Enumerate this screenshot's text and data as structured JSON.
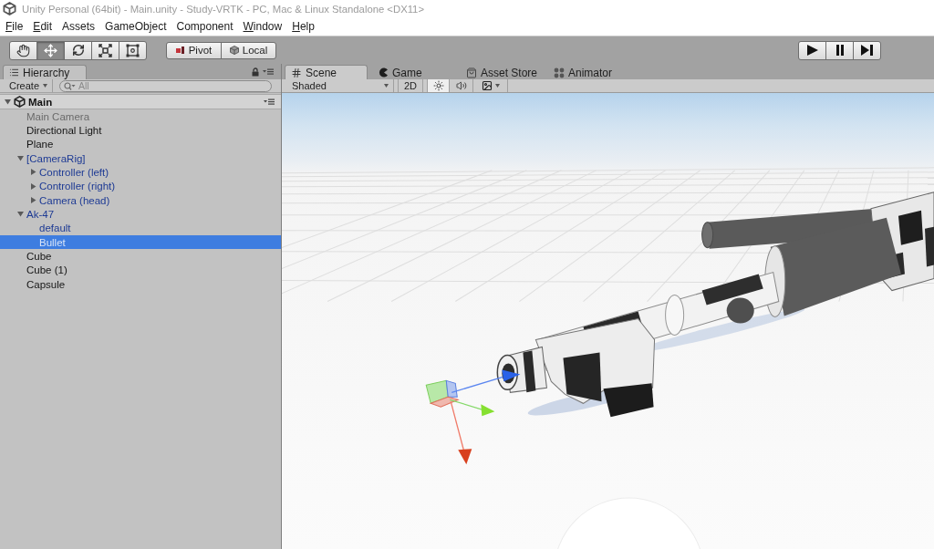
{
  "window": {
    "title": "Unity Personal (64bit) - Main.unity - Study-VRTK - PC, Mac & Linux Standalone <DX11>"
  },
  "menu_bar": [
    {
      "label": "File",
      "mnemonic": true
    },
    {
      "label": "Edit",
      "mnemonic": true
    },
    {
      "label": "Assets",
      "mnemonic": false
    },
    {
      "label": "GameObject",
      "mnemonic": false
    },
    {
      "label": "Component",
      "mnemonic": false
    },
    {
      "label": "Window",
      "mnemonic": true
    },
    {
      "label": "Help",
      "mnemonic": true
    }
  ],
  "toolbar": {
    "tools": [
      {
        "kind": "hand",
        "selected": false
      },
      {
        "kind": "move",
        "selected": true
      },
      {
        "kind": "rotate",
        "selected": false
      },
      {
        "kind": "scale",
        "selected": false
      },
      {
        "kind": "rect",
        "selected": false
      }
    ],
    "handle_buttons": [
      {
        "kind": "pivot",
        "label": "Pivot"
      },
      {
        "kind": "local",
        "label": "Local"
      }
    ],
    "play_controls": [
      {
        "kind": "play"
      },
      {
        "kind": "pause"
      },
      {
        "kind": "step"
      }
    ]
  },
  "hierarchy": {
    "tab": "Hierarchy",
    "create_button": "Create",
    "search": {
      "placeholder": "All"
    },
    "scene": {
      "name": "Main",
      "expanded": true,
      "children": [
        {
          "name": "Main Camera",
          "prefab": false,
          "active": false,
          "selected": false
        },
        {
          "name": "Directional Light",
          "prefab": false,
          "active": true,
          "selected": false
        },
        {
          "name": "Plane",
          "prefab": false,
          "active": true,
          "selected": false
        },
        {
          "name": "[CameraRig]",
          "expanded": true,
          "prefab": true,
          "active": true,
          "selected": false,
          "children": [
            {
              "name": "Controller (left)",
              "expanded": false,
              "prefab": true,
              "active": true,
              "selected": false
            },
            {
              "name": "Controller (right)",
              "expanded": false,
              "prefab": true,
              "active": true,
              "selected": false
            },
            {
              "name": "Camera (head)",
              "expanded": false,
              "prefab": true,
              "active": true,
              "selected": false
            }
          ]
        },
        {
          "name": "Ak-47",
          "expanded": true,
          "prefab": true,
          "active": true,
          "selected": false,
          "children": [
            {
              "name": "default",
              "prefab": true,
              "active": true,
              "selected": false
            },
            {
              "name": "Bullet",
              "prefab": true,
              "active": true,
              "selected": true
            }
          ]
        },
        {
          "name": "Cube",
          "prefab": false,
          "active": true,
          "selected": false
        },
        {
          "name": "Cube (1)",
          "prefab": false,
          "active": true,
          "selected": false
        },
        {
          "name": "Capsule",
          "prefab": false,
          "active": true,
          "selected": false
        }
      ]
    }
  },
  "scene_view": {
    "tabs": [
      {
        "kind": "scene",
        "label": "Scene",
        "selected": true
      },
      {
        "kind": "game",
        "label": "Game",
        "selected": false
      },
      {
        "kind": "store",
        "label": "Asset Store",
        "selected": false
      },
      {
        "kind": "animator",
        "label": "Animator",
        "selected": false
      }
    ],
    "shading": "Shaded",
    "mode_2d": {
      "label": "2D",
      "on": false
    },
    "toggles": [
      {
        "kind": "lighting",
        "on": true
      },
      {
        "kind": "audio",
        "on": false
      },
      {
        "kind": "effects",
        "on": false
      }
    ]
  }
}
